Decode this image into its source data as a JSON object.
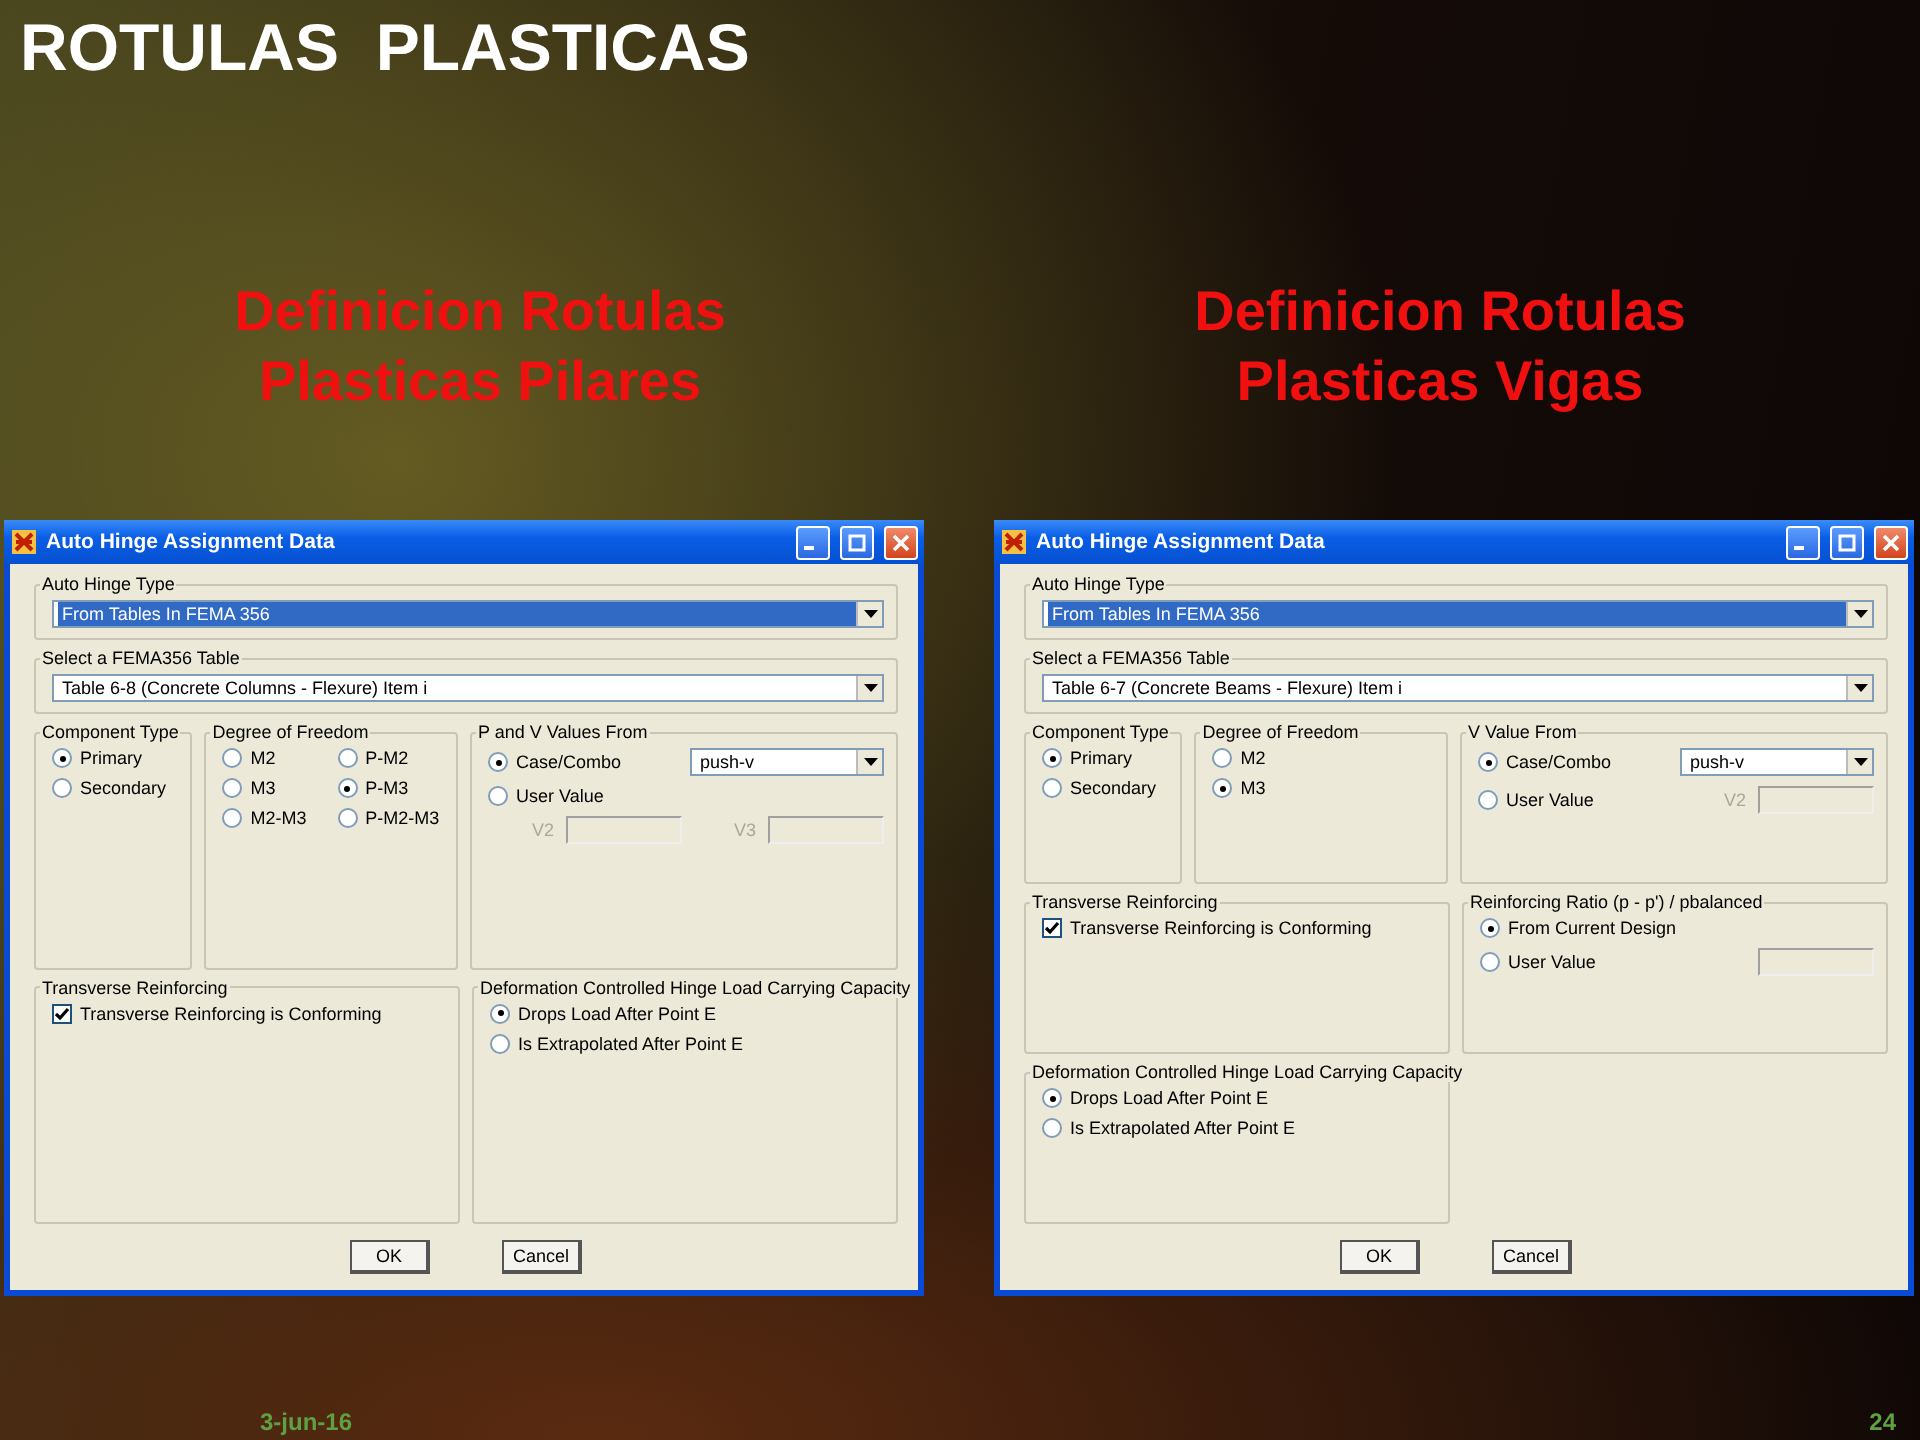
{
  "slide": {
    "title": "ROTULAS  PLASTICAS",
    "footer_date": "3-jun-16",
    "page_number": "24"
  },
  "columns": [
    {
      "heading": "Definicion Rotulas Plasticas Pilares",
      "dialog": {
        "title": "Auto Hinge Assignment Data",
        "sections": [
          {
            "groups": [
              {
                "legend": "Auto Hinge Type",
                "lines": [
                  [
                    {
                      "kind": "dropdown",
                      "value": "From Tables In FEMA 356",
                      "highlighted": true
                    }
                  ]
                ]
              }
            ]
          },
          {
            "groups": [
              {
                "legend": "Select a FEMA356 Table",
                "lines": [
                  [
                    {
                      "kind": "dropdown",
                      "value": "Table 6-8 (Concrete Columns - Flexure) Item i",
                      "highlighted": false
                    }
                  ]
                ]
              }
            ]
          },
          {
            "groups": [
              {
                "legend": "Component Type",
                "lines": [
                  [
                    {
                      "kind": "radio",
                      "label": "Primary",
                      "selected": true
                    }
                  ],
                  [
                    {
                      "kind": "radio",
                      "label": "Secondary",
                      "selected": false
                    }
                  ]
                ]
              },
              {
                "legend": "Degree of Freedom",
                "lines": [
                  [
                    {
                      "kind": "radio",
                      "label": "M2",
                      "selected": false
                    },
                    {
                      "kind": "radio",
                      "label": "P-M2",
                      "selected": false
                    }
                  ],
                  [
                    {
                      "kind": "radio",
                      "label": "M3",
                      "selected": false
                    },
                    {
                      "kind": "radio",
                      "label": "P-M3",
                      "selected": true
                    }
                  ],
                  [
                    {
                      "kind": "radio",
                      "label": "M2-M3",
                      "selected": false
                    },
                    {
                      "kind": "radio",
                      "label": "P-M2-M3",
                      "selected": false
                    }
                  ]
                ]
              },
              {
                "legend": "P and V Values From",
                "lines": [
                  [
                    {
                      "kind": "radio",
                      "label": "Case/Combo",
                      "selected": true
                    },
                    {
                      "kind": "dropdown",
                      "value": "push-v",
                      "highlighted": false
                    }
                  ],
                  [
                    {
                      "kind": "radio",
                      "label": "User Value",
                      "selected": false
                    }
                  ],
                  [
                    {
                      "kind": "field",
                      "label": "V2",
                      "disabled": true
                    },
                    {
                      "kind": "field",
                      "label": "V3",
                      "disabled": true
                    }
                  ]
                ]
              }
            ]
          },
          {
            "groups": [
              {
                "legend": "Transverse Reinforcing",
                "lines": [
                  [
                    {
                      "kind": "checkbox",
                      "label": "Transverse Reinforcing is Conforming",
                      "checked": true
                    }
                  ]
                ]
              },
              {
                "legend": "Deformation Controlled Hinge Load Carrying Capacity",
                "lines": [
                  [
                    {
                      "kind": "radio",
                      "label": "Drops Load After Point E",
                      "selected": true
                    }
                  ],
                  [
                    {
                      "kind": "radio",
                      "label": "Is Extrapolated After Point E",
                      "selected": false
                    }
                  ]
                ]
              }
            ]
          }
        ],
        "buttons": [
          "OK",
          "Cancel"
        ]
      }
    },
    {
      "heading": "Definicion Rotulas Plasticas Vigas",
      "dialog": {
        "title": "Auto Hinge Assignment Data",
        "sections": [
          {
            "groups": [
              {
                "legend": "Auto Hinge Type",
                "lines": [
                  [
                    {
                      "kind": "dropdown",
                      "value": "From Tables In FEMA 356",
                      "highlighted": true
                    }
                  ]
                ]
              }
            ]
          },
          {
            "groups": [
              {
                "legend": "Select a FEMA356 Table",
                "lines": [
                  [
                    {
                      "kind": "dropdown",
                      "value": "Table 6-7 (Concrete Beams - Flexure) Item i",
                      "highlighted": false
                    }
                  ]
                ]
              }
            ]
          },
          {
            "groups": [
              {
                "legend": "Component Type",
                "lines": [
                  [
                    {
                      "kind": "radio",
                      "label": "Primary",
                      "selected": true
                    }
                  ],
                  [
                    {
                      "kind": "radio",
                      "label": "Secondary",
                      "selected": false
                    }
                  ]
                ]
              },
              {
                "legend": "Degree of Freedom",
                "lines": [
                  [
                    {
                      "kind": "radio",
                      "label": "M2",
                      "selected": false
                    }
                  ],
                  [
                    {
                      "kind": "radio",
                      "label": "M3",
                      "selected": true
                    }
                  ]
                ]
              },
              {
                "legend": "V Value From",
                "lines": [
                  [
                    {
                      "kind": "radio",
                      "label": "Case/Combo",
                      "selected": true
                    },
                    {
                      "kind": "dropdown",
                      "value": "push-v",
                      "highlighted": false
                    }
                  ],
                  [
                    {
                      "kind": "radio",
                      "label": "User Value",
                      "selected": false
                    },
                    {
                      "kind": "field",
                      "label": "V2",
                      "disabled": true
                    }
                  ]
                ]
              }
            ]
          },
          {
            "groups": [
              {
                "legend": "Transverse Reinforcing",
                "lines": [
                  [
                    {
                      "kind": "checkbox",
                      "label": "Transverse Reinforcing is Conforming",
                      "checked": true
                    }
                  ]
                ]
              },
              {
                "legend": "Reinforcing Ratio  (p - p') / pbalanced",
                "lines": [
                  [
                    {
                      "kind": "radio",
                      "label": "From Current Design",
                      "selected": true
                    }
                  ],
                  [
                    {
                      "kind": "radio",
                      "label": "User Value",
                      "selected": false
                    },
                    {
                      "kind": "field",
                      "disabled": true
                    }
                  ]
                ]
              }
            ]
          },
          {
            "groups": [
              {
                "legend": "Deformation Controlled Hinge Load Carrying Capacity",
                "lines": [
                  [
                    {
                      "kind": "radio",
                      "label": "Drops Load After Point E",
                      "selected": true
                    }
                  ],
                  [
                    {
                      "kind": "radio",
                      "label": "Is Extrapolated After Point E",
                      "selected": false
                    }
                  ]
                ]
              }
            ]
          }
        ],
        "buttons": [
          "OK",
          "Cancel"
        ]
      }
    }
  ]
}
